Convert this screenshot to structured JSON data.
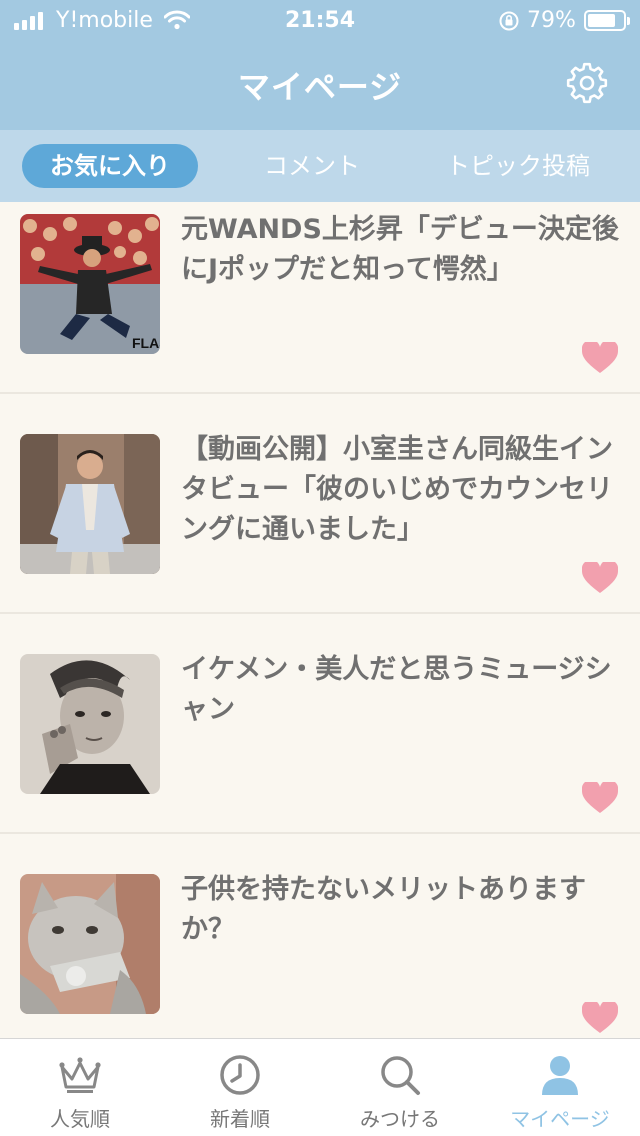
{
  "status_bar": {
    "carrier": "Y!mobile",
    "time": "21:54",
    "battery": "79%",
    "battery_level": 0.79
  },
  "header": {
    "title": "マイページ",
    "settings_icon": "gear-icon"
  },
  "tabs": [
    {
      "label": "お気に入り",
      "active": true
    },
    {
      "label": "コメント",
      "active": false
    },
    {
      "label": "トピック投稿",
      "active": false
    }
  ],
  "topics": [
    {
      "title": "元WANDS上杉昇「デビュー決定後にJポップだと知って愕然」",
      "thumb_caption": "FLAS",
      "favorite": true
    },
    {
      "title": "【動画公開】小室圭さん同級生インタビュー「彼のいじめでカウンセリングに通いました」",
      "favorite": true
    },
    {
      "title": "イケメン・美人だと思うミュージシャン",
      "favorite": true
    },
    {
      "title": "子供を持たないメリットありますか？",
      "favorite": true
    }
  ],
  "tabbar": [
    {
      "label": "人気順",
      "icon": "crown-icon",
      "active": false
    },
    {
      "label": "新着順",
      "icon": "clock-icon",
      "active": false
    },
    {
      "label": "みつける",
      "icon": "search-icon",
      "active": false
    },
    {
      "label": "マイページ",
      "icon": "user-icon",
      "active": true
    }
  ],
  "colors": {
    "header": "#a3c9e1",
    "tabs_bg": "#bed8ea",
    "active_tab": "#5ea8d8",
    "heart": "#f2a0ae",
    "active_tabbar": "#8fc3e4",
    "background": "#faf7f0"
  }
}
